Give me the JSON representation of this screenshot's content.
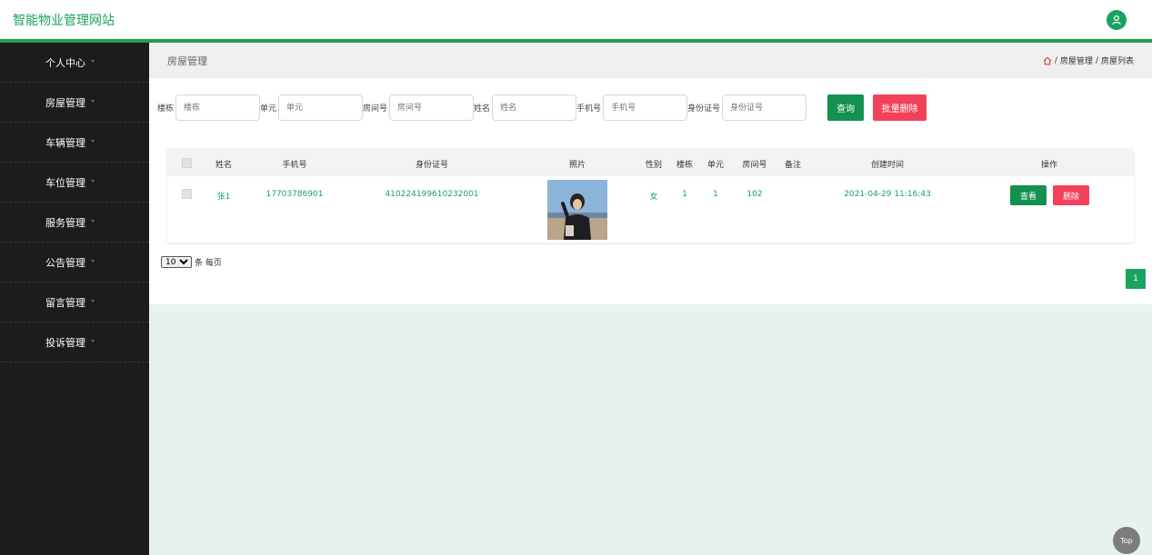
{
  "app": {
    "title": "智能物业管理网站"
  },
  "colors": {
    "accent": "#1aa260",
    "danger": "#f2415a",
    "sidebar_bg": "#1c1c1c"
  },
  "icons": {
    "user": "user-icon",
    "home": "home-icon",
    "caret": "caret-down-icon"
  },
  "sidebar": {
    "items": [
      {
        "label": "个人中心"
      },
      {
        "label": "房屋管理"
      },
      {
        "label": "车辆管理"
      },
      {
        "label": "车位管理"
      },
      {
        "label": "服务管理"
      },
      {
        "label": "公告管理"
      },
      {
        "label": "留言管理"
      },
      {
        "label": "投诉管理"
      }
    ]
  },
  "page": {
    "title": "房屋管理",
    "breadcrumb": {
      "sep": "/",
      "section": "房屋管理",
      "current": "房屋列表"
    }
  },
  "search": {
    "fields": [
      {
        "label": "楼栋",
        "placeholder": "楼栋"
      },
      {
        "label": "单元",
        "placeholder": "单元"
      },
      {
        "label": "房间号",
        "placeholder": "房间号"
      },
      {
        "label": "姓名",
        "placeholder": "姓名"
      },
      {
        "label": "手机号",
        "placeholder": "手机号"
      },
      {
        "label": "身份证号",
        "placeholder": "身份证号"
      }
    ],
    "query_label": "查询",
    "batch_delete_label": "批量删除"
  },
  "table": {
    "headers": [
      "姓名",
      "手机号",
      "身份证号",
      "照片",
      "性别",
      "楼栋",
      "单元",
      "房间号",
      "备注",
      "创建时间",
      "操作"
    ],
    "rows": [
      {
        "name": "张1",
        "phone": "17703786901",
        "id_number": "410224199610232001",
        "gender": "女",
        "building": "1",
        "unit": "1",
        "room": "102",
        "note": "",
        "created": "2021-04-29 11:16:43",
        "view_label": "查看",
        "delete_label": "删除"
      }
    ]
  },
  "pagination": {
    "page_size": "10",
    "page_size_suffix": "条 每页",
    "current_page": "1"
  },
  "back_to_top": "Top"
}
